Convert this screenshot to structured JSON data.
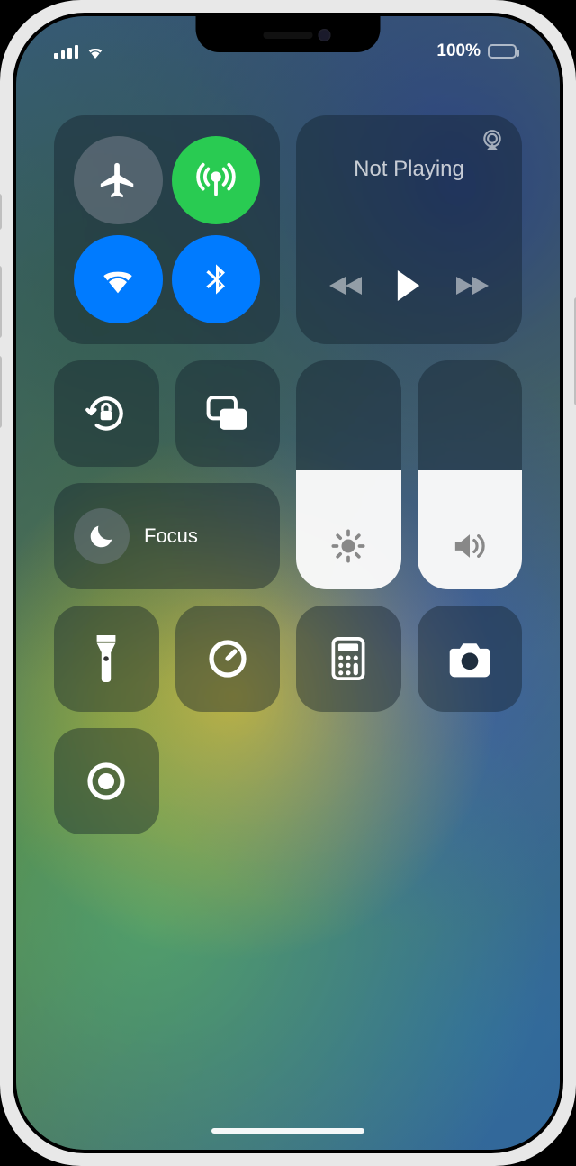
{
  "status": {
    "battery_pct": "100%",
    "battery_fill_pct": 100
  },
  "connectivity": {
    "airplane": {
      "name": "airplane-mode",
      "active": false
    },
    "cellular": {
      "name": "cellular-data",
      "active": true
    },
    "wifi": {
      "name": "wifi",
      "active": true
    },
    "bluetooth": {
      "name": "bluetooth",
      "active": true
    }
  },
  "media": {
    "title": "Not Playing",
    "controls": {
      "prev": "rewind",
      "play": "play",
      "next": "fast-forward"
    },
    "airplay": "airplay"
  },
  "row3": {
    "orientation_lock": "orientation-lock",
    "screen_mirroring": "screen-mirroring"
  },
  "focus": {
    "label": "Focus",
    "icon": "moon"
  },
  "sliders": {
    "brightness": {
      "level_pct": 52,
      "icon": "sun"
    },
    "volume": {
      "level_pct": 52,
      "icon": "speaker"
    }
  },
  "shortcuts": [
    {
      "name": "flashlight",
      "icon": "flashlight"
    },
    {
      "name": "timer",
      "icon": "timer"
    },
    {
      "name": "calculator",
      "icon": "calculator"
    },
    {
      "name": "camera",
      "icon": "camera"
    },
    {
      "name": "screen-record",
      "icon": "record"
    }
  ]
}
